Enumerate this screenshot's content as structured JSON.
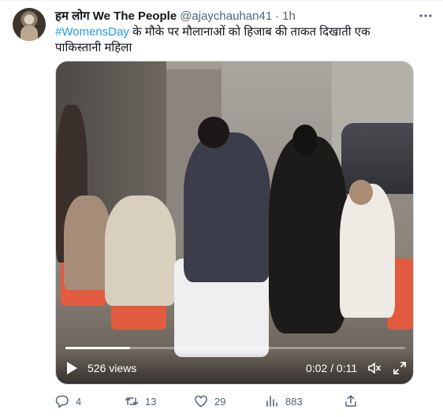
{
  "tweet": {
    "author_name": "हम लोग We The People",
    "handle": "@ajaychauhan41",
    "separator": "·",
    "time": "1h",
    "hashtag": "#WomensDay",
    "text": " के मौके पर मौलानाओं को हिजाब की ताकत दिखाती एक पाकिस्तानी महिला"
  },
  "video": {
    "views": "526 views",
    "timer": "0:02 / 0:11",
    "progress_fraction": 0.19
  },
  "actions": {
    "replies": "4",
    "retweets": "13",
    "likes": "29",
    "views": "883"
  },
  "colors": {
    "accent": "#1d9bf0",
    "secondary_text": "#536471"
  }
}
